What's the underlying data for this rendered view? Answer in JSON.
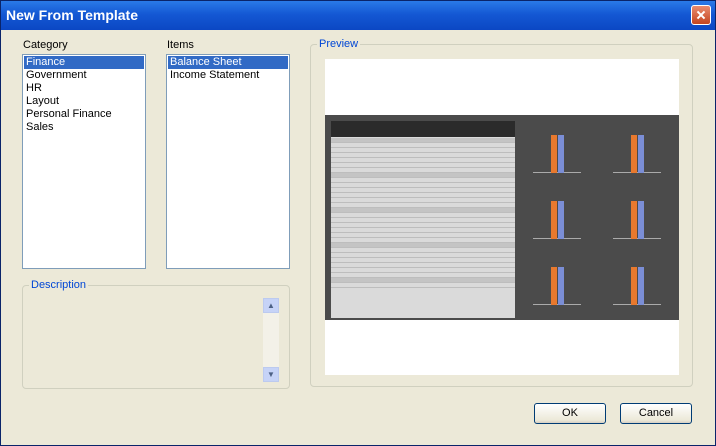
{
  "window": {
    "title": "New From Template"
  },
  "category": {
    "label": "Category",
    "items": [
      "Finance",
      "Government",
      "HR",
      "Layout",
      "Personal Finance",
      "Sales"
    ],
    "selected_index": 0
  },
  "items": {
    "label": "Items",
    "list": [
      "Balance Sheet",
      "Income Statement"
    ],
    "selected_index": 0
  },
  "preview": {
    "label": "Preview"
  },
  "description": {
    "label": "Description"
  },
  "buttons": {
    "ok": "OK",
    "cancel": "Cancel"
  },
  "colors": {
    "selection": "#316ac5",
    "group_title": "#0046d5",
    "titlebar": "#0b47c4"
  }
}
